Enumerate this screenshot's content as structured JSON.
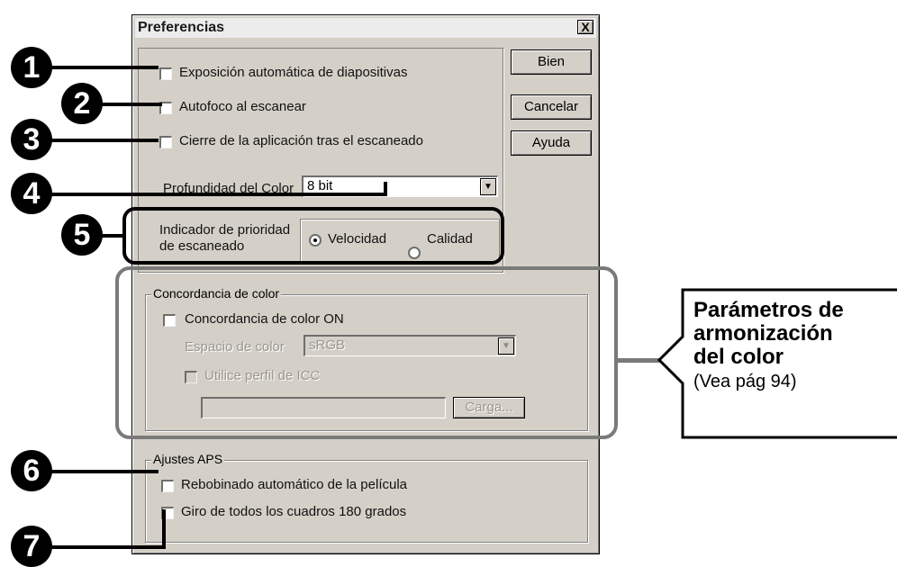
{
  "dialog": {
    "title": "Preferencias",
    "close_label": "X",
    "options": {
      "auto_exposure": "Exposición automática de diapositivas",
      "autofocus": "Autofoco al escanear",
      "close_app": "Cierre de la aplicación tras el escaneado"
    },
    "buttons": {
      "ok": "Bien",
      "cancel": "Cancelar",
      "help": "Ayuda"
    },
    "color_depth": {
      "label": "Profundidad del Color",
      "value": "8 bit"
    },
    "scan_priority": {
      "label_line1": "Indicador de prioridad",
      "label_line2": "de escaneado",
      "option_speed": "Velocidad",
      "option_quality": "Calidad",
      "selected": "Velocidad"
    },
    "color_matching": {
      "group_title": "Concordancia de color",
      "toggle_label": "Concordancia de color ON",
      "color_space_label": "Espacio de color",
      "color_space_value": "sRGB",
      "icc_label": "Utilice perfil de ICC",
      "icc_path": "",
      "load_button": "Carga..."
    },
    "aps": {
      "group_title": "Ajustes APS",
      "rewind": "Rebobinado automático de la película",
      "rotate": "Giro de todos los cuadros 180 grados"
    }
  },
  "callouts": [
    "1",
    "2",
    "3",
    "4",
    "5",
    "6",
    "7"
  ],
  "annotation": {
    "title_line1": "Parámetros de",
    "title_line2": "armonización",
    "title_line3": "del color",
    "subtitle": "(Vea pág 94)"
  },
  "colors": {
    "dialog_bg": "#d4d0c8",
    "highlight_box": "#7a7a7a",
    "callout": "#000000"
  }
}
